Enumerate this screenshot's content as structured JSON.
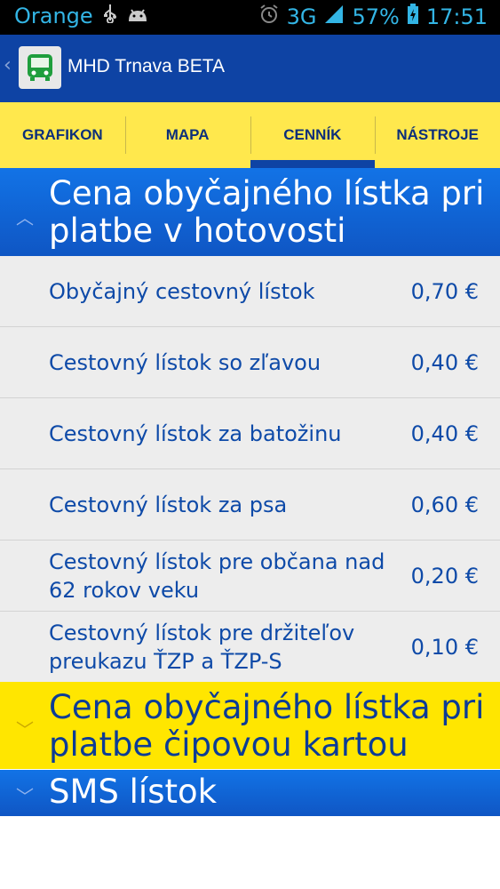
{
  "status_bar": {
    "carrier": "Orange",
    "network": "3G",
    "battery": "57%",
    "time": "17:51",
    "icons": [
      "usb-icon",
      "android-icon",
      "alarm-icon",
      "signal-icon",
      "battery-icon"
    ]
  },
  "action_bar": {
    "title": "MHD Trnava BETA",
    "icon": "bus-icon"
  },
  "tabs": [
    {
      "label": "GRAFIKON",
      "active": false
    },
    {
      "label": "MAPA",
      "active": false
    },
    {
      "label": "CENNÍK",
      "active": true
    },
    {
      "label": "NÁSTROJE",
      "active": false
    }
  ],
  "sections": [
    {
      "title": "Cena obyčajného lístka pri platbe v hotovosti",
      "expanded": true,
      "items": [
        {
          "name": "Obyčajný cestovný lístok",
          "price": "0,70 €"
        },
        {
          "name": "Cestovný lístok so zľavou",
          "price": "0,40 €"
        },
        {
          "name": "Cestovný lístok za batožinu",
          "price": "0,40 €"
        },
        {
          "name": "Cestovný lístok za psa",
          "price": "0,60 €"
        },
        {
          "name": "Cestovný lístok pre občana nad 62 rokov veku",
          "price": "0,20 €"
        },
        {
          "name": "Cestovný lístok pre držiteľov preukazu ŤZP a ŤZP-S",
          "price": "0,10 €"
        }
      ]
    },
    {
      "title": "Cena obyčajného lístka pri platbe čipovou kartou",
      "expanded": false
    },
    {
      "title": "SMS lístok",
      "expanded": false
    }
  ],
  "colors": {
    "action_bar": "#0e43a4",
    "tab_bar": "#ffe84d",
    "section_blue": "#1273e6",
    "section_yellow": "#ffe600",
    "list_text": "#0e4aa8"
  }
}
